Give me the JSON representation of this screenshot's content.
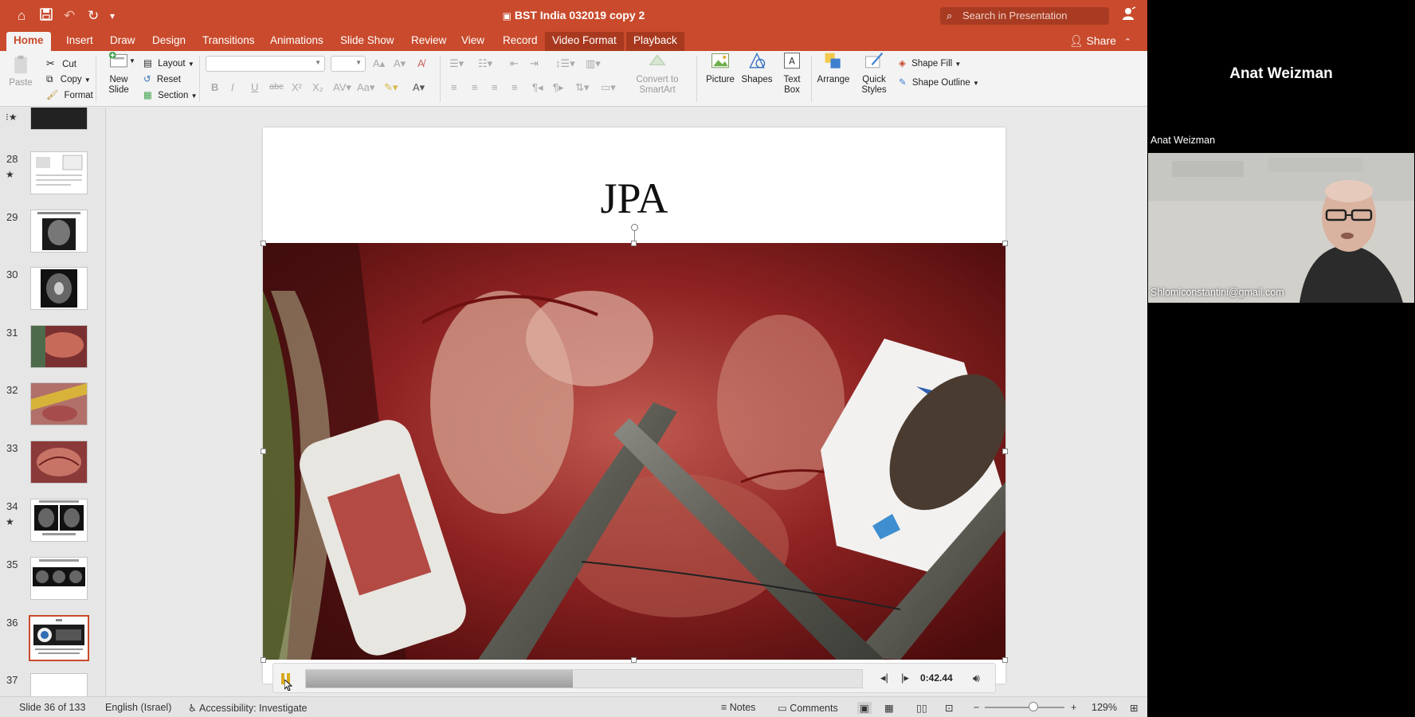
{
  "window": {
    "title": "BST India 032019 copy 2",
    "search_placeholder": "Search in Presentation"
  },
  "tabs": [
    {
      "label": "Home",
      "active": true
    },
    {
      "label": "Insert"
    },
    {
      "label": "Draw"
    },
    {
      "label": "Design"
    },
    {
      "label": "Transitions"
    },
    {
      "label": "Animations"
    },
    {
      "label": "Slide Show"
    },
    {
      "label": "Review"
    },
    {
      "label": "View"
    },
    {
      "label": "Record"
    },
    {
      "label": "Video Format",
      "contextual": true
    },
    {
      "label": "Playback",
      "contextual": true
    }
  ],
  "share_label": "Share",
  "ribbon": {
    "paste": "Paste",
    "cut": "Cut",
    "copy": "Copy",
    "format": "Format",
    "new_slide_1": "New",
    "new_slide_2": "Slide",
    "layout": "Layout",
    "reset": "Reset",
    "section": "Section",
    "convert_1": "Convert to",
    "convert_2": "SmartArt",
    "picture": "Picture",
    "shapes": "Shapes",
    "textbox_1": "Text",
    "textbox_2": "Box",
    "arrange": "Arrange",
    "quick_styles_1": "Quick",
    "quick_styles_2": "Styles",
    "shape_fill": "Shape Fill",
    "shape_outline": "Shape Outline"
  },
  "thumbnails": [
    {
      "num": "",
      "star": true
    },
    {
      "num": "28",
      "star": true
    },
    {
      "num": "29",
      "star": false
    },
    {
      "num": "30",
      "star": false
    },
    {
      "num": "31",
      "star": false
    },
    {
      "num": "32",
      "star": false
    },
    {
      "num": "33",
      "star": false
    },
    {
      "num": "34",
      "star": true
    },
    {
      "num": "35",
      "star": false
    },
    {
      "num": "36",
      "star": false,
      "selected": true
    },
    {
      "num": "37",
      "star": false
    }
  ],
  "slide": {
    "title": "JPA"
  },
  "video": {
    "timecode": "0:42.44",
    "progress": 0.48
  },
  "status": {
    "slide_info": "Slide 36 of 133",
    "language": "English (Israel)",
    "accessibility": "Accessibility: Investigate",
    "notes": "Notes",
    "comments": "Comments",
    "zoom": "129%"
  },
  "meeting": {
    "active_speaker": "Anat Weizman",
    "tile_name": "Anat Weizman",
    "tile_email": "Shlomiconstantini@gmail.com"
  },
  "colors": {
    "accent": "#c94a2c",
    "selected_thumb": "#c94a2c"
  }
}
